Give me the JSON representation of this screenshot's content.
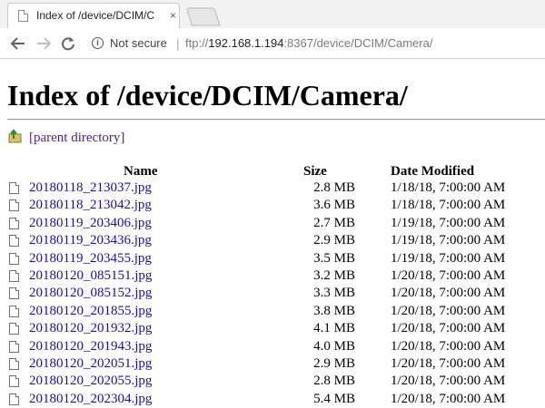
{
  "browser": {
    "tab_title": "Index of /device/DCIM/C",
    "tab_close": "×",
    "security_label": "Not secure",
    "url_scheme": "ftp://",
    "url_host": "192.168.1.194",
    "url_rest": ":8367/device/DCIM/Camera/"
  },
  "page": {
    "heading": "Index of /device/DCIM/Camera/",
    "parent_link": "[parent directory]",
    "columns": {
      "name": "Name",
      "size": "Size",
      "date": "Date Modified"
    },
    "files": [
      {
        "name": "20180118_213037.jpg",
        "size": "2.8 MB",
        "date": "1/18/18, 7:00:00 AM"
      },
      {
        "name": "20180118_213042.jpg",
        "size": "3.6 MB",
        "date": "1/18/18, 7:00:00 AM"
      },
      {
        "name": "20180119_203406.jpg",
        "size": "2.7 MB",
        "date": "1/19/18, 7:00:00 AM"
      },
      {
        "name": "20180119_203436.jpg",
        "size": "2.9 MB",
        "date": "1/19/18, 7:00:00 AM"
      },
      {
        "name": "20180119_203455.jpg",
        "size": "3.5 MB",
        "date": "1/19/18, 7:00:00 AM"
      },
      {
        "name": "20180120_085151.jpg",
        "size": "3.2 MB",
        "date": "1/20/18, 7:00:00 AM"
      },
      {
        "name": "20180120_085152.jpg",
        "size": "3.3 MB",
        "date": "1/20/18, 7:00:00 AM"
      },
      {
        "name": "20180120_201855.jpg",
        "size": "3.8 MB",
        "date": "1/20/18, 7:00:00 AM"
      },
      {
        "name": "20180120_201932.jpg",
        "size": "4.1 MB",
        "date": "1/20/18, 7:00:00 AM"
      },
      {
        "name": "20180120_201943.jpg",
        "size": "4.0 MB",
        "date": "1/20/18, 7:00:00 AM"
      },
      {
        "name": "20180120_202051.jpg",
        "size": "2.9 MB",
        "date": "1/20/18, 7:00:00 AM"
      },
      {
        "name": "20180120_202055.jpg",
        "size": "2.8 MB",
        "date": "1/20/18, 7:00:00 AM"
      },
      {
        "name": "20180120_202304.jpg",
        "size": "5.4 MB",
        "date": "1/20/18, 7:00:00 AM"
      }
    ]
  }
}
